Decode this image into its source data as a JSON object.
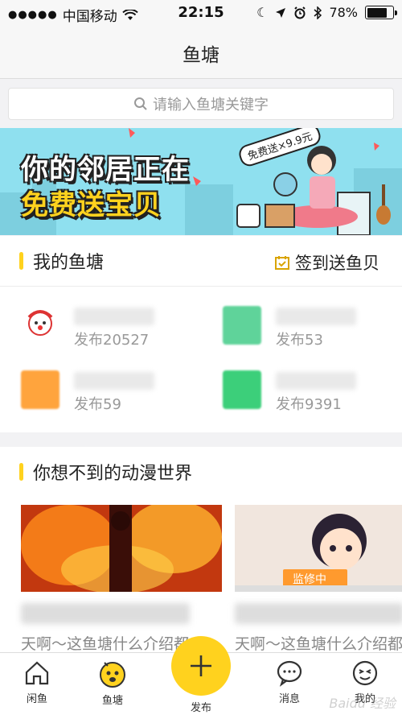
{
  "status_bar": {
    "signal_dots": "●●●●●",
    "carrier": "中国移动",
    "time": "22:15",
    "battery_percent": "78%",
    "battery_level": 0.78
  },
  "nav": {
    "title": "鱼塘"
  },
  "search": {
    "placeholder": "请输入鱼塘关键字"
  },
  "banner": {
    "line1": "你的邻居正在",
    "line2": "免费送宝贝",
    "bubble": "免费送×9.9元"
  },
  "my_ponds": {
    "title": "我的鱼塘",
    "checkin_label": "签到送鱼贝",
    "items": [
      {
        "count": "发布20527",
        "icon_color": "#e8e0e0"
      },
      {
        "count": "发布53",
        "icon_color": "#5fd39a"
      },
      {
        "count": "发布59",
        "icon_color": "#ffa43d"
      },
      {
        "count": "发布9391",
        "icon_color": "#3ccf7a"
      }
    ]
  },
  "anime_section": {
    "title": "你想不到的动漫世界",
    "cards": [
      {
        "desc": "天啊～这鱼塘什么介绍都"
      },
      {
        "desc": "天啊～这鱼塘什么介绍都",
        "tag": "监修中"
      }
    ]
  },
  "tabbar": {
    "tabs": [
      "闲鱼",
      "鱼塘",
      "发布",
      "消息",
      "我的"
    ]
  },
  "watermark": "Baidu 经验",
  "colors": {
    "accent": "#ffd21e",
    "banner_bg": "#8fe0ef"
  }
}
